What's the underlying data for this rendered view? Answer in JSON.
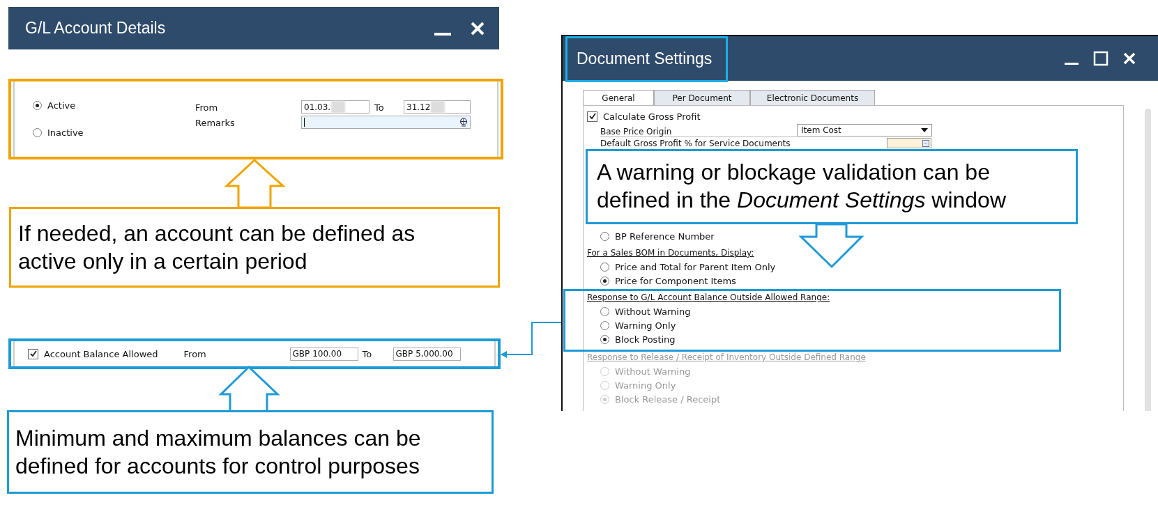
{
  "gl_window": {
    "title": "G/L Account Details",
    "status_options": [
      {
        "label": "Active",
        "selected": true
      },
      {
        "label": "Inactive",
        "selected": false
      }
    ],
    "from_label": "From",
    "from_value": "01.03.",
    "to_label": "To",
    "to_value": "31.12",
    "remarks_label": "Remarks"
  },
  "gl_callout": {
    "text": "If needed, an account can be defined as active only in a certain period"
  },
  "balance_row": {
    "checked": true,
    "label": "Account Balance Allowed",
    "from_label": "From",
    "from_value": "GBP 100.00",
    "to_label": "To",
    "to_value": "GBP 5,000.00"
  },
  "balance_callout": {
    "text": "Minimum and maximum balances can be defined for accounts for control purposes"
  },
  "doc_window": {
    "title": "Document Settings",
    "tabs": [
      {
        "label": "General",
        "selected": true
      },
      {
        "label": "Per Document",
        "selected": false
      },
      {
        "label": "Electronic Documents",
        "selected": false
      }
    ],
    "calc_gross_profit": {
      "label": "Calculate Gross Profit",
      "checked": true
    },
    "base_price_origin": {
      "label": "Base Price Origin",
      "value": "Item Cost"
    },
    "default_gp_label": "Default Gross Profit % for Service Documents",
    "groups": [
      {
        "options": [
          {
            "label": "BP Reference Number",
            "selected": false
          }
        ],
        "disabled": false
      },
      {
        "heading": "For a Sales BOM in Documents, Display:",
        "disabled": false,
        "options": [
          {
            "label": "Price and Total for Parent Item Only",
            "selected": false
          },
          {
            "label": "Price for Component Items",
            "selected": true
          }
        ]
      },
      {
        "heading": "Response to G/L Account Balance Outside Allowed Range:",
        "disabled": false,
        "options": [
          {
            "label": "Without Warning",
            "selected": false
          },
          {
            "label": "Warning Only",
            "selected": false
          },
          {
            "label": "Block Posting",
            "selected": true
          }
        ]
      },
      {
        "heading": "Response to Release / Receipt of Inventory Outside Defined Range",
        "disabled": true,
        "options": [
          {
            "label": "Without Warning",
            "selected": false
          },
          {
            "label": "Warning Only",
            "selected": false
          },
          {
            "label": "Block Release / Receipt",
            "selected": true
          }
        ]
      }
    ]
  },
  "doc_callout": {
    "text": "A warning or blockage validation can be defined in the *Document Settings* window"
  }
}
